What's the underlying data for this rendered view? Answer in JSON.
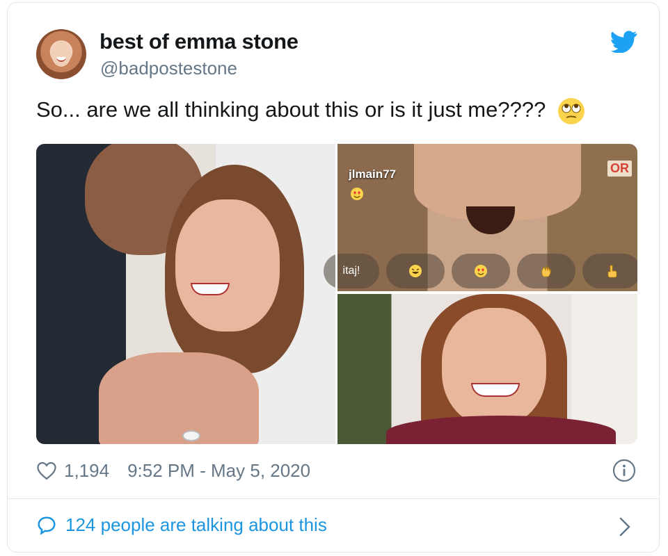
{
  "tweet": {
    "display_name": "best of emma stone",
    "handle": "@badpostestone",
    "text": "So... are we all thinking about this or is it just me????",
    "media": {
      "username_tag": "jlmain77",
      "reaction_left_text": "itaj!",
      "sign_text": "OR"
    },
    "likes": "1,194",
    "timestamp": "9:52 PM - May 5, 2020",
    "talking": "124 people are talking about this"
  },
  "icons": {
    "brand": "twitter-bird-icon",
    "like": "heart-icon",
    "info": "info-icon",
    "reply": "speech-bubble-icon",
    "more": "chevron-right-icon"
  },
  "colors": {
    "twitter_blue": "#1da1f2",
    "link_blue": "#1b95e0",
    "text": "#14171a",
    "muted": "#657786",
    "border": "#e1e8ed"
  }
}
